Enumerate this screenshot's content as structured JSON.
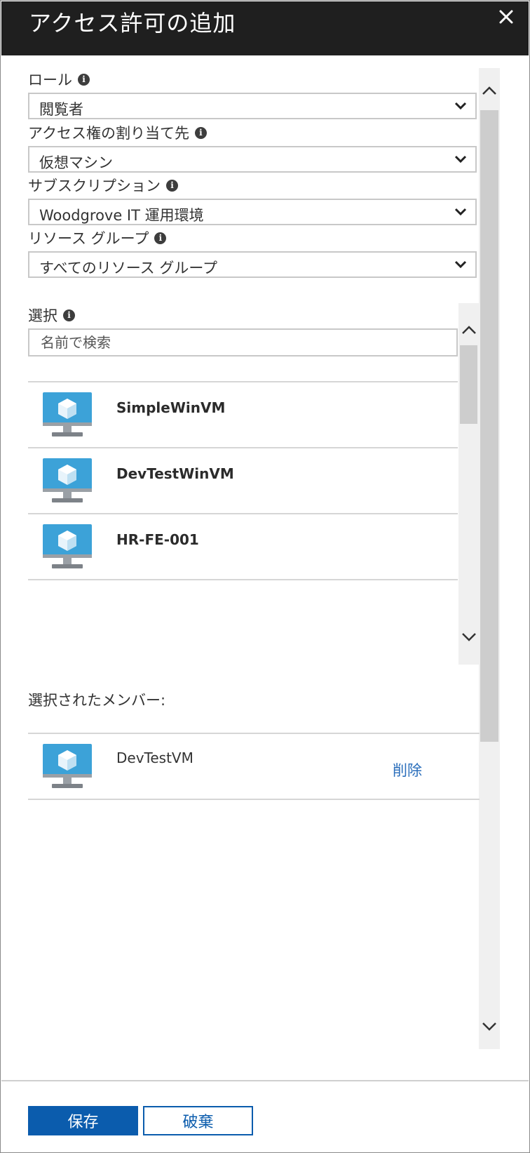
{
  "header": {
    "title": "アクセス許可の追加"
  },
  "role": {
    "label": "ロール",
    "value": "閲覧者"
  },
  "assign_to": {
    "label": "アクセス権の割り当て先",
    "value": "仮想マシン"
  },
  "subscription": {
    "label": "サブスクリプション",
    "value": "Woodgrove IT 運用環境"
  },
  "resource_group": {
    "label": "リソース グループ",
    "value": "すべてのリソース グループ"
  },
  "select": {
    "label": "選択",
    "placeholder": "名前で検索"
  },
  "vm_list": [
    {
      "name": "SimpleWinVM"
    },
    {
      "name": "DevTestWinVM"
    },
    {
      "name": "HR-FE-001"
    }
  ],
  "selected_members": {
    "label": "選択されたメンバー:",
    "items": [
      {
        "name": "DevTestVM",
        "remove_label": "削除"
      }
    ]
  },
  "footer": {
    "save_label": "保存",
    "discard_label": "破棄"
  },
  "colors": {
    "header_bg": "#1f1f1f",
    "primary": "#0b5cad",
    "link": "#2a6ebb",
    "vm_icon": "#3ca2d8"
  },
  "icons": {
    "close": "close-icon",
    "info": "info-icon",
    "chevron": "chevron-down-icon",
    "vm": "virtual-machine-icon"
  }
}
